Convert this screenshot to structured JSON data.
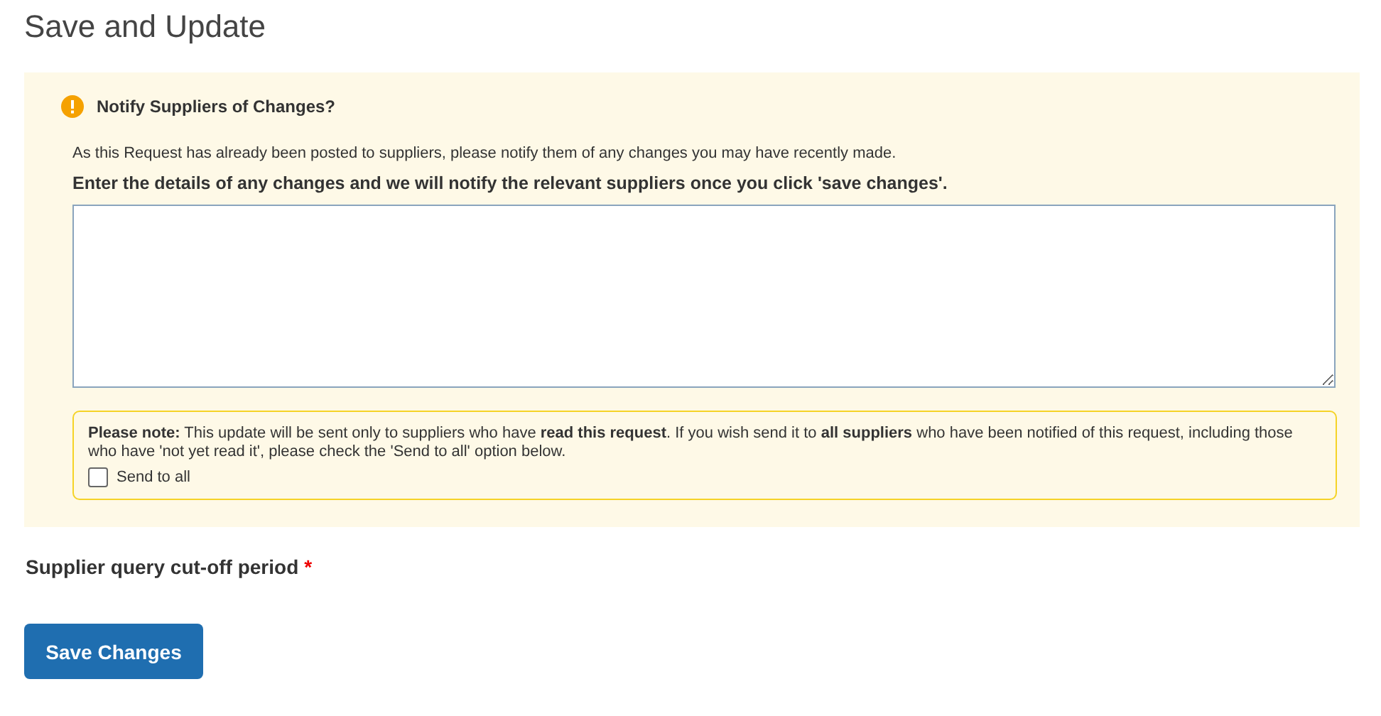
{
  "page_title": "Save and Update",
  "notify_panel": {
    "heading": "Notify Suppliers of Changes?",
    "intro": "As this Request has already been posted to suppliers, please notify them of any changes you may have recently made.",
    "prompt": "Enter the details of any changes and we will notify the relevant suppliers once you click 'save changes'.",
    "note": "**Please note:** This update will be sent only to suppliers who have **read this request**. If you wish send it to **all suppliers** who have been notified of this request, including those who have 'not yet read it', please check the 'Send to all' option below.",
    "send_to_all": {
      "label": "Send to all",
      "checked": false
    }
  },
  "cutoff_field": {
    "label": "Supplier query cut-off period",
    "required_mark": "*"
  },
  "buttons": [
    {
      "label": "Save Changes",
      "kind": "primary"
    }
  ]
}
